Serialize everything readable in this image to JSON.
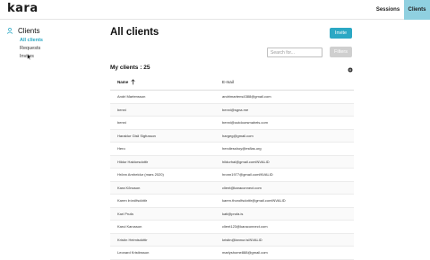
{
  "header": {
    "logo": "kara",
    "nav": {
      "sessions": "Sessions",
      "clients": "Clients"
    },
    "active_nav": "Clients",
    "accent_color": "#8fd0e0"
  },
  "sidebar": {
    "title": "Clients",
    "icon": "person-icon",
    "items": [
      {
        "label": "All clients",
        "active": true
      },
      {
        "label": "Requests",
        "active": false
      },
      {
        "label": "Invites",
        "active": false
      }
    ]
  },
  "main": {
    "title": "All clients",
    "invite_label": "Invite",
    "search_placeholder": "Search for...",
    "filters_label": "Filters",
    "count_label": "My clients : 25",
    "primary_color": "#2ba8c4",
    "table": {
      "columns": [
        "Name",
        "E-mail"
      ],
      "rows": [
        {
          "name": "Andri Martensson",
          "email": "andrimartens4388@gmail.com"
        },
        {
          "name": "benni",
          "email": "benni@sgna.me"
        },
        {
          "name": "benni",
          "email": "benni@outdoorsmaheis.com"
        },
        {
          "name": "Haraldur Gisli Sigfusson",
          "email": "hargeg@gmail.com"
        },
        {
          "name": "Hero",
          "email": "hercilesshoy@esflas.org"
        },
        {
          "name": "Hildur Haldorsdottir",
          "email": "hildurhal@gmail.comINVALID"
        },
        {
          "name": "Hrönn Arnheidur (mars 2020)",
          "email": "hronn1977@gmail.comINVALID"
        },
        {
          "name": "Kara Kõnuson",
          "email": "client@karaconnect.com"
        },
        {
          "name": "Karen Þórólfsdóttir",
          "email": "karen.thorolfsdottir@gmail.comINVALID"
        },
        {
          "name": "Kari Prufa",
          "email": "kati@prufa.is"
        },
        {
          "name": "Karui Karusson",
          "email": "client123@karaconnect.com"
        },
        {
          "name": "Kristín Heimisdóttir",
          "email": "kristin@lannur.isINVALID"
        },
        {
          "name": "Leonard Kristinsson",
          "email": "marlyshome888@gmail.com"
        }
      ]
    }
  }
}
